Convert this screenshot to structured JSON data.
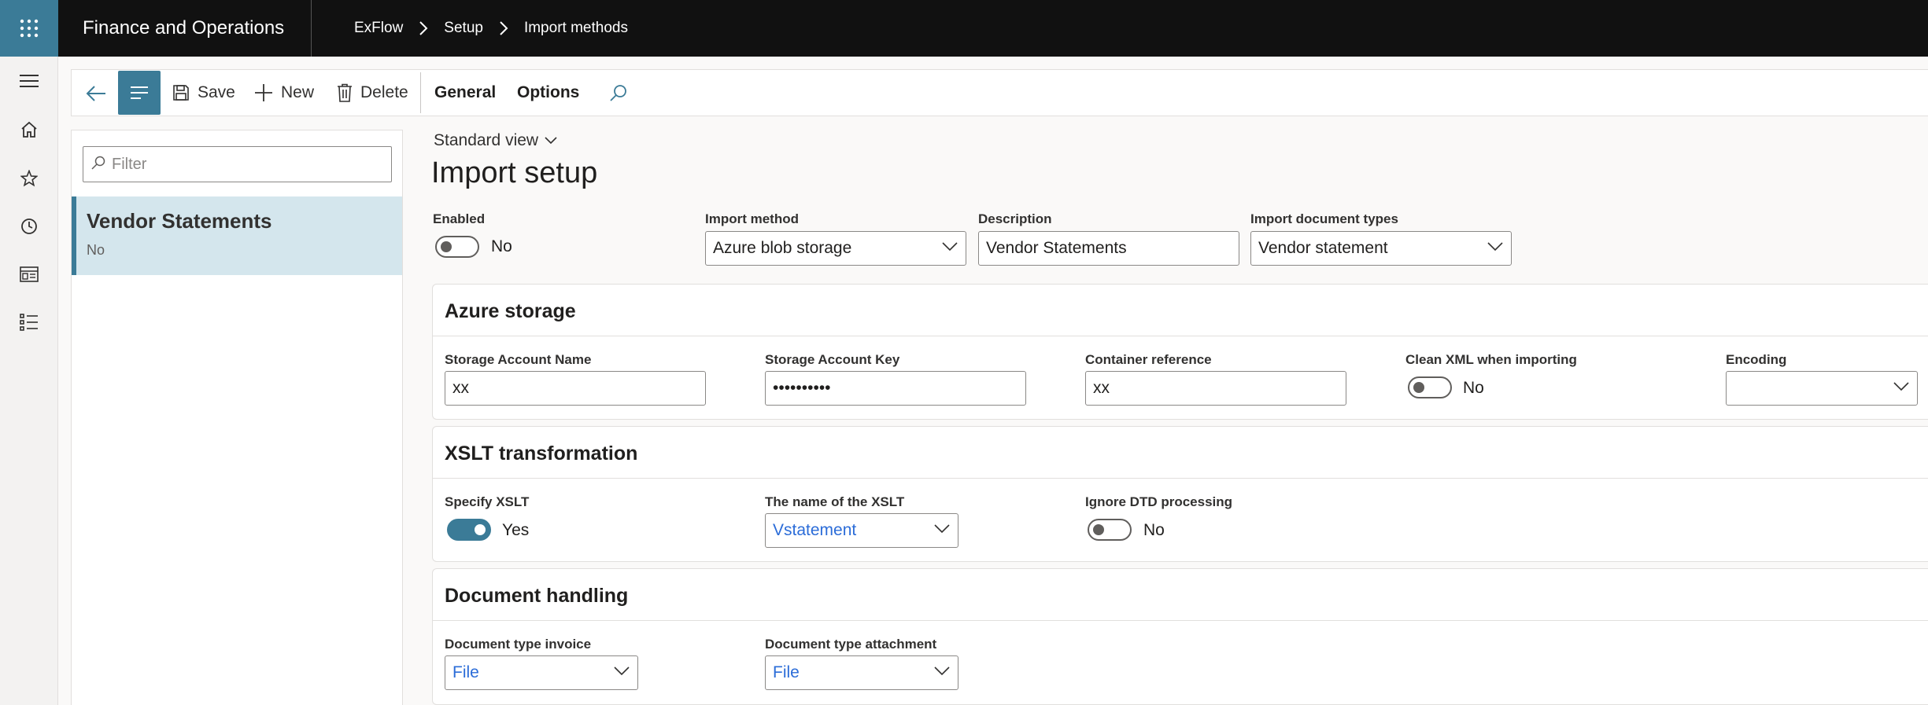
{
  "app": {
    "title": "Finance and Operations"
  },
  "breadcrumb": [
    "ExFlow",
    "Setup",
    "Import methods"
  ],
  "toolbar": {
    "save_label": "Save",
    "new_label": "New",
    "delete_label": "Delete",
    "tabs": [
      "General",
      "Options"
    ]
  },
  "list": {
    "filter_placeholder": "Filter",
    "items": [
      {
        "title": "Vendor Statements",
        "subtitle": "No"
      }
    ]
  },
  "view": {
    "label": "Standard view"
  },
  "page": {
    "title": "Import setup"
  },
  "header_fields": {
    "enabled": {
      "label": "Enabled",
      "value": "No",
      "on": false
    },
    "import_method": {
      "label": "Import method",
      "value": "Azure blob storage"
    },
    "description": {
      "label": "Description",
      "value": "Vendor Statements"
    },
    "import_document_types": {
      "label": "Import document types",
      "value": "Vendor statement"
    }
  },
  "sections": {
    "azure": {
      "title": "Azure storage",
      "storage_account_name": {
        "label": "Storage Account Name",
        "value": "xx"
      },
      "storage_account_key": {
        "label": "Storage Account Key",
        "value": "••••••••••"
      },
      "container_reference": {
        "label": "Container reference",
        "value": "xx"
      },
      "clean_xml": {
        "label": "Clean XML when importing",
        "value": "No",
        "on": false
      },
      "encoding": {
        "label": "Encoding",
        "value": ""
      }
    },
    "xslt": {
      "title": "XSLT transformation",
      "specify_xslt": {
        "label": "Specify XSLT",
        "value": "Yes",
        "on": true
      },
      "xslt_name": {
        "label": "The name of the XSLT",
        "value": "Vstatement"
      },
      "ignore_dtd": {
        "label": "Ignore DTD processing",
        "value": "No",
        "on": false
      }
    },
    "document_handling": {
      "title": "Document handling",
      "doc_type_invoice": {
        "label": "Document type invoice",
        "value": "File"
      },
      "doc_type_attachment": {
        "label": "Document type attachment",
        "value": "File"
      }
    }
  },
  "colors": {
    "accent": "#3b7b97",
    "topbar": "#111111",
    "link": "#2b6cd8",
    "selected_row": "#d4e6ed"
  },
  "icons": [
    "waffle-icon",
    "chevron-right-icon",
    "hamburger-icon",
    "home-icon",
    "star-icon",
    "clock-icon",
    "workspace-icon",
    "list-icon",
    "back-arrow-icon",
    "lines-icon",
    "save-icon",
    "plus-icon",
    "trash-icon",
    "search-icon",
    "chevron-down-icon"
  ]
}
